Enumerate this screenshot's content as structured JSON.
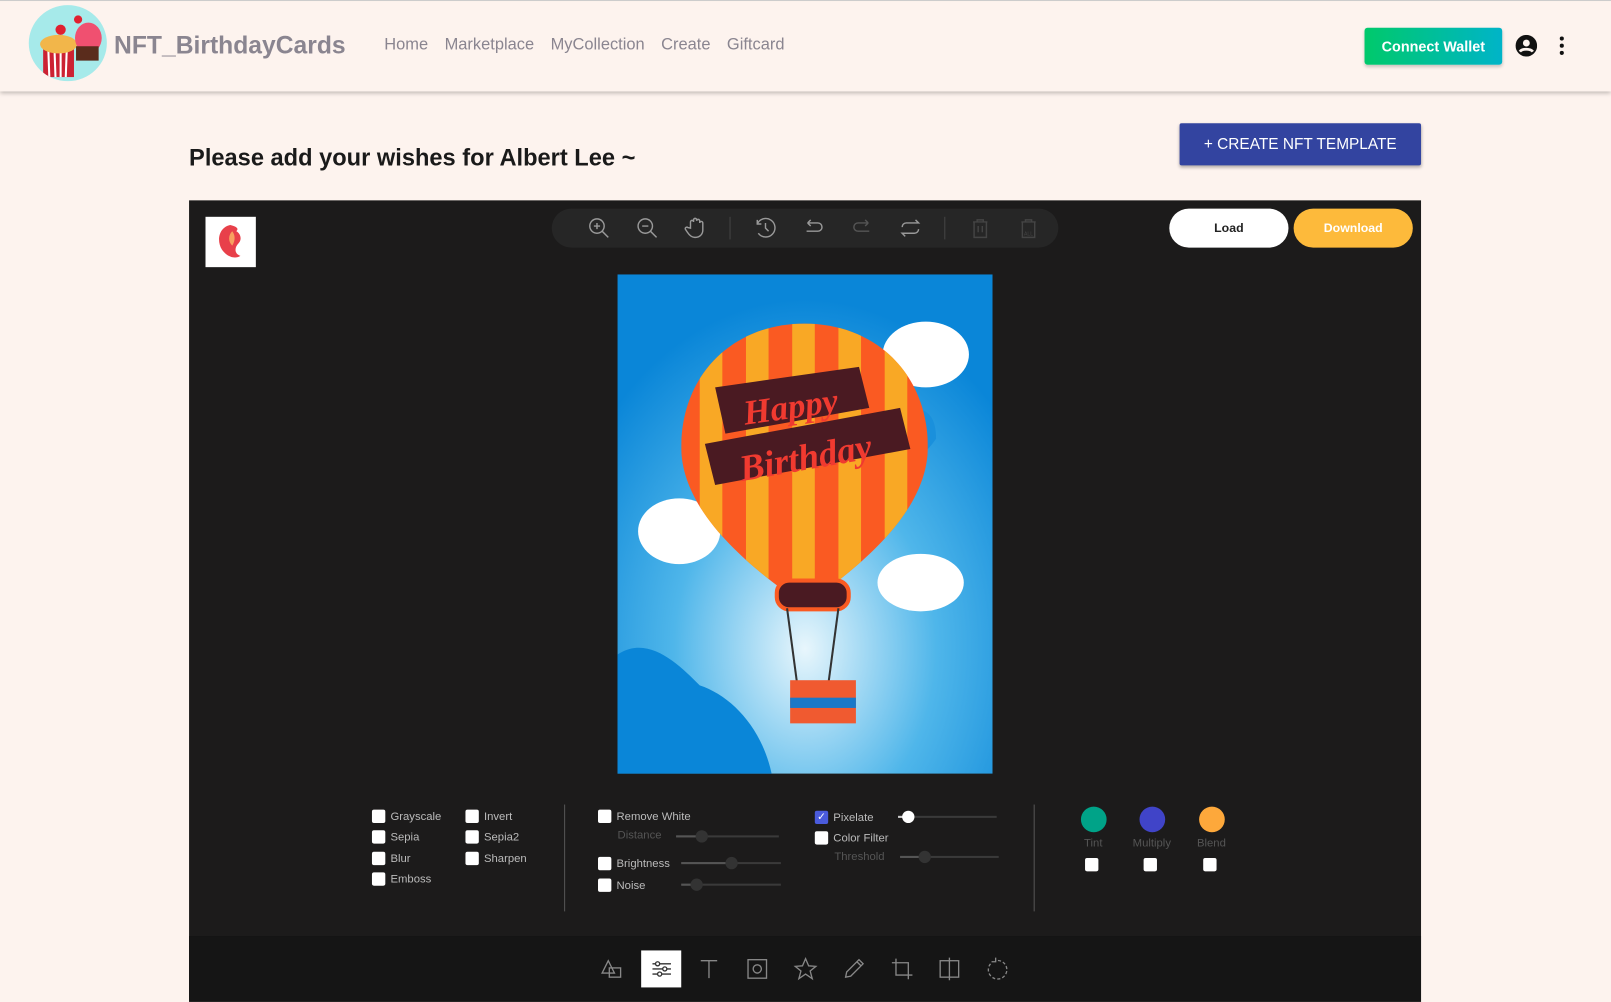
{
  "header": {
    "brand": "NFT_BirthdayCards",
    "nav": [
      "Home",
      "Marketplace",
      "MyCollection",
      "Create",
      "Giftcard"
    ],
    "connect_wallet": "Connect Wallet",
    "accent": "#00c96b"
  },
  "page": {
    "title": "Please add your wishes for Albert Lee ~",
    "create_template": "+ CREATE NFT TEMPLATE"
  },
  "editor": {
    "toolbar": [
      "zoom-in",
      "zoom-out",
      "hand",
      "history",
      "undo",
      "redo",
      "reset",
      "delete",
      "delete-all"
    ],
    "load": "Load",
    "download": "Download",
    "card_lettering": "Happy Birthday",
    "filters": {
      "basic": [
        {
          "label": "Grayscale",
          "checked": false
        },
        {
          "label": "Invert",
          "checked": false
        },
        {
          "label": "Sepia",
          "checked": false
        },
        {
          "label": "Sepia2",
          "checked": false
        },
        {
          "label": "Blur",
          "checked": false
        },
        {
          "label": "Sharpen",
          "checked": false
        },
        {
          "label": "Emboss",
          "checked": false
        }
      ],
      "remove_white": "Remove White",
      "distance": "Distance",
      "brightness": "Brightness",
      "noise": "Noise",
      "pixelate": "Pixelate",
      "pixelate_checked": true,
      "color_filter": "Color Filter",
      "threshold": "Threshold",
      "distance_value": 0.25,
      "brightness_value": 0.5,
      "noise_value": 0.15,
      "pixelate_value": 0.1,
      "threshold_value": 0.25,
      "tint": "Tint",
      "multiply": "Multiply",
      "blend": "Blend",
      "tint_color": "#00a388",
      "multiply_color": "#4044c8",
      "blend_color": "#fda83b"
    },
    "bottom_tools": [
      "shape",
      "filter",
      "text",
      "mask",
      "icon",
      "draw",
      "crop",
      "flip",
      "rotate"
    ],
    "active_bottom_tool": "filter"
  }
}
